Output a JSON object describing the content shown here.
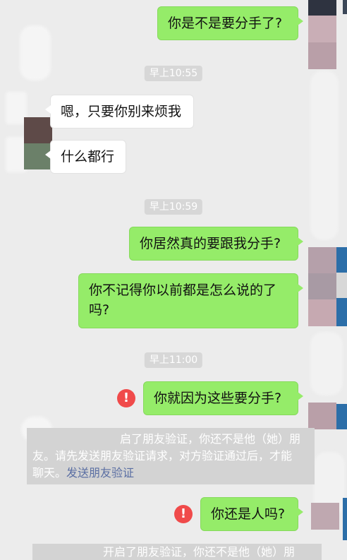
{
  "timestamps": [
    "早上10:55",
    "早上10:59",
    "早上11:00"
  ],
  "messages": [
    {
      "side": "out",
      "text": "你是不是要分手了?"
    },
    {
      "side": "in",
      "text": "嗯，只要你别来烦我"
    },
    {
      "side": "in",
      "text": "什么都行"
    },
    {
      "side": "out",
      "text": "你居然真的要跟我分手?"
    },
    {
      "side": "out",
      "text_line1": "你不记得你以前都是怎么说的了",
      "text_line2": "吗?"
    },
    {
      "side": "out",
      "text": "你就因为这些要分手?",
      "failed": true
    },
    {
      "side": "out",
      "text": "你还是人吗?",
      "failed": true
    }
  ],
  "notice": {
    "line1": "启了朋友验证，你还不是他（她）朋",
    "line2": "友。请先发送朋友验证请求，对方验证通过后，才能",
    "line3_prefix": "聊天。",
    "link": "发送朋友验证"
  },
  "notice_bottom": {
    "text": "开启了朋友验证，你还不是他（她）朋"
  },
  "error_icon_symbol": "!",
  "colors": {
    "background": "#ececec",
    "outgoing_bubble": "#95ec69",
    "incoming_bubble": "#ffffff",
    "timestamp_bg": "#d7d7d7",
    "error_red": "#f04a4a",
    "link_blue": "#5b6fa3"
  }
}
